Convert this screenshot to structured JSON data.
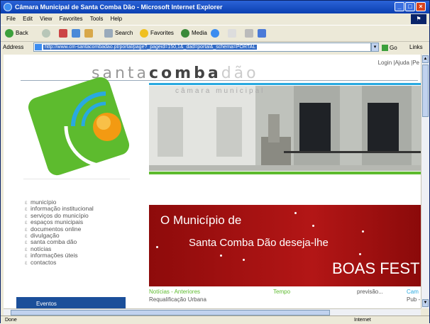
{
  "window": {
    "title": "Câmara Municipal de Santa Comba Dão - Microsoft Internet Explorer",
    "buttons": {
      "min": "_",
      "max": "□",
      "close": "×"
    }
  },
  "menubar": [
    "File",
    "Edit",
    "View",
    "Favorites",
    "Tools",
    "Help"
  ],
  "toolbar": {
    "back": "Back",
    "search": "Search",
    "favorites": "Favorites",
    "media": "Media"
  },
  "address": {
    "label": "Address",
    "url": "http://www.cm-santacombadao.pt/portal/page?_pageid=150,1&_dad=portal&_schema=PORTAL",
    "go": "Go",
    "links": "Links"
  },
  "site": {
    "toplinks": "Login  |Ajuda  |Pe",
    "brand_light": "santa",
    "brand_bold": "comba",
    "brand_faint": "dão",
    "subbrand": "câmara municipal",
    "menu": [
      "município",
      "informação institucional",
      "serviços do município",
      "espaços municipais",
      "documentos online",
      "divulgação",
      "santa comba dão",
      "notícias",
      "informações úteis",
      "contactos"
    ],
    "banner": {
      "line1": "O Município de",
      "line2": "Santa Comba Dão deseja-lhe",
      "line3": "BOAS FEST"
    },
    "news_headers": {
      "news": "Notícias - Anteriores",
      "weather": "Tempo",
      "forecast": "previsão...",
      "cam": "Cam"
    },
    "news_item": "Requalificação Urbana",
    "weather_extra": "Pub -",
    "bluebox": "Eventos"
  },
  "status": {
    "left": "Done",
    "right": "Internet"
  },
  "colors": {
    "title_bar": "#0a3fb0",
    "banner_red": "#a51212",
    "accent_blue": "#29a9e0",
    "accent_green": "#5dbb2e"
  }
}
